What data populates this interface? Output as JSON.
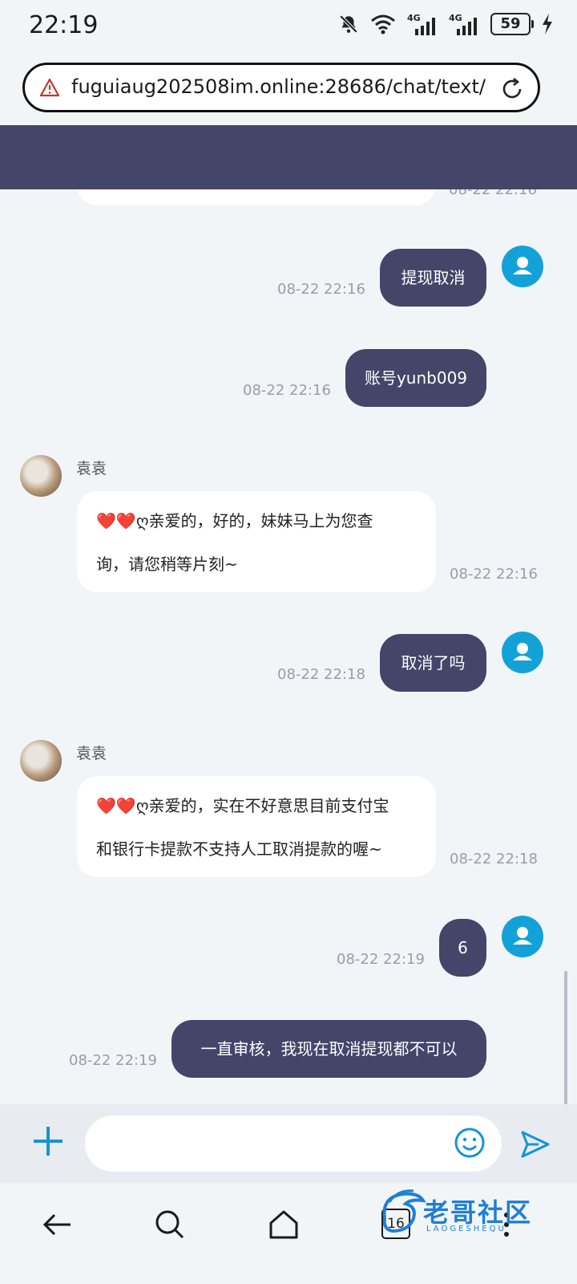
{
  "status_bar": {
    "time": "22:19",
    "network_1": "4G",
    "network_2": "4G",
    "battery": "59",
    "icons": [
      "bell-off-icon",
      "wifi-icon",
      "signal-icon",
      "signal-icon",
      "battery-icon",
      "charging-icon"
    ]
  },
  "browser": {
    "url": "fuguiaug202508im.online:28686/chat/text/",
    "icons": [
      "warning-icon",
      "reload-icon"
    ]
  },
  "colors": {
    "header": "#434569",
    "outgoing_bubble": "#434569",
    "accent": "#13a2d8",
    "background": "#f2f5f8"
  },
  "chat": {
    "clipped_timestamp": "08-22 22:16",
    "messages": [
      {
        "side": "right",
        "text": "提现取消",
        "time": "08-22 22:16"
      },
      {
        "side": "right",
        "text": "账号yunb009",
        "time": "08-22 22:16"
      },
      {
        "side": "left",
        "sender": "袁袁",
        "line1_prefix": "❤️❤️",
        "line1": "ღ亲爱的，好的，妹妹马上为您查",
        "line2": "询，请您稍等片刻~",
        "time": "08-22 22:16"
      },
      {
        "side": "right",
        "text": "取消了吗",
        "time": "08-22 22:18"
      },
      {
        "side": "left",
        "sender": "袁袁",
        "line1_prefix": "❤️❤️",
        "line1": "ღ亲爱的，实在不好意思目前支付宝",
        "line2": "和银行卡提款不支持人工取消提款的喔~",
        "time": "08-22 22:18"
      },
      {
        "side": "right",
        "text": "6",
        "time": "08-22 22:19"
      },
      {
        "side": "right",
        "text": "一直审核，我现在取消提现都不可以",
        "time": "08-22 22:19"
      }
    ]
  },
  "composer": {
    "placeholder": "",
    "icons": [
      "plus-icon",
      "emoji-icon",
      "send-icon"
    ]
  },
  "nav": {
    "tab_count": "16",
    "icons": [
      "back-icon",
      "search-icon",
      "home-icon",
      "tabs-icon",
      "menu-icon"
    ]
  },
  "watermark": {
    "text": "老哥社区",
    "sub": "LAOGESHEQU"
  }
}
